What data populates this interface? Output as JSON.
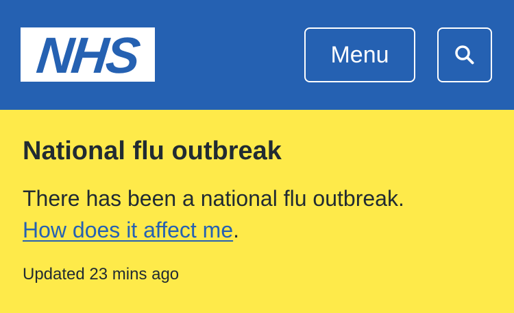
{
  "header": {
    "logo_text": "NHS",
    "menu_label": "Menu",
    "search_icon": "search-icon",
    "background_color": "#2561b2"
  },
  "alert": {
    "title": "National flu outbreak",
    "body_text": "There has been a national flu outbreak.",
    "link_text": "How does it affect me",
    "link_suffix": ".",
    "updated_text": "Updated 23 mins ago",
    "background_color": "#feea4a",
    "link_color": "#2561b2"
  }
}
